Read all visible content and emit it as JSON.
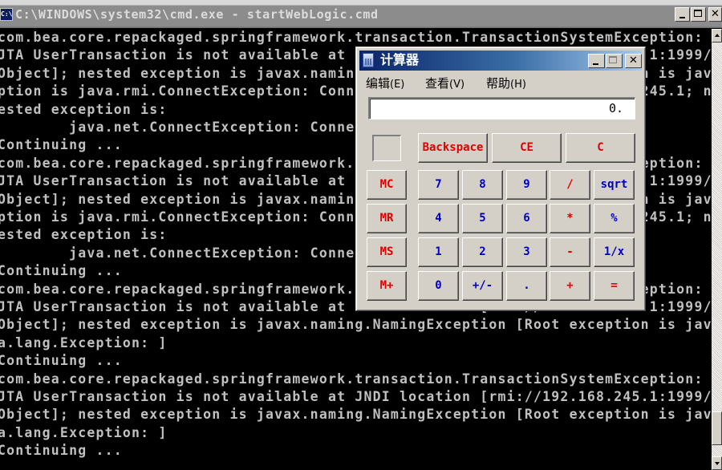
{
  "cmd_window": {
    "title": "C:\\WINDOWS\\system32\\cmd.exe - startWebLogic.cmd",
    "icon": "cmd-icon",
    "icon_text": "C:\\",
    "controls": {
      "minimize": "minimize-icon",
      "maximize": "maximize-icon",
      "close": "close-icon"
    },
    "console_lines": [
      "com.bea.core.repackaged.springframework.transaction.TransactionSystemException:",
      "JTA UserTransaction is not available at JNDI location [rmi://192.168.245.1:1999/",
      "Object]; nested exception is javax.naming.NamingException [Root exception is jav",
      "ption is java.rmi.ConnectException: Connection refused to host: 192.168.245.1; n",
      "ested exception is:",
      "        java.net.ConnectException: Connection refused: connect]",
      "Continuing ...",
      "com.bea.core.repackaged.springframework.transaction.TransactionSystemException:",
      "JTA UserTransaction is not available at JNDI location [rmi://192.168.245.1:1999/",
      "Object]; nested exception is javax.naming.NamingException [Root exception is jav",
      "ption is java.rmi.ConnectException: Connection refused to host: 192.168.245.1; n",
      "ested exception is:",
      "        java.net.ConnectException: Connection refused: connect]",
      "Continuing ...",
      "com.bea.core.repackaged.springframework.transaction.TransactionSystemException:",
      "JTA UserTransaction is not available at JNDI location [rmi://192.168.245.1:1999/",
      "Object]; nested exception is javax.naming.NamingException [Root exception is jav",
      "a.lang.Exception: ]",
      "Continuing ...",
      "com.bea.core.repackaged.springframework.transaction.TransactionSystemException:",
      "JTA UserTransaction is not available at JNDI location [rmi://192.168.245.1:1999/",
      "Object]; nested exception is javax.naming.NamingException [Root exception is jav",
      "a.lang.Exception: ]",
      "Continuing ..."
    ],
    "scrollbar": {
      "position_fraction": 0.97
    }
  },
  "calculator": {
    "title": "计算器",
    "icon": "calculator-icon",
    "menu": [
      {
        "label": "编辑",
        "accel": "(E)"
      },
      {
        "label": "查看",
        "accel": "(V)"
      },
      {
        "label": "帮助",
        "accel": "(H)"
      }
    ],
    "display_value": "0.",
    "memory_indicator": "",
    "top_buttons": [
      "Backspace",
      "CE",
      "C"
    ],
    "rows": [
      [
        {
          "label": "MC",
          "color": "red"
        },
        {
          "label": "7",
          "color": "blue"
        },
        {
          "label": "8",
          "color": "blue"
        },
        {
          "label": "9",
          "color": "blue"
        },
        {
          "label": "/",
          "color": "red"
        },
        {
          "label": "sqrt",
          "color": "blue"
        }
      ],
      [
        {
          "label": "MR",
          "color": "red"
        },
        {
          "label": "4",
          "color": "blue"
        },
        {
          "label": "5",
          "color": "blue"
        },
        {
          "label": "6",
          "color": "blue"
        },
        {
          "label": "*",
          "color": "red"
        },
        {
          "label": "%",
          "color": "blue"
        }
      ],
      [
        {
          "label": "MS",
          "color": "red"
        },
        {
          "label": "1",
          "color": "blue"
        },
        {
          "label": "2",
          "color": "blue"
        },
        {
          "label": "3",
          "color": "blue"
        },
        {
          "label": "-",
          "color": "red"
        },
        {
          "label": "1/x",
          "color": "blue"
        }
      ],
      [
        {
          "label": "M+",
          "color": "red"
        },
        {
          "label": "0",
          "color": "blue"
        },
        {
          "label": "+/-",
          "color": "blue"
        },
        {
          "label": ".",
          "color": "blue"
        },
        {
          "label": "+",
          "color": "red"
        },
        {
          "label": "=",
          "color": "red"
        }
      ]
    ],
    "colors": {
      "red_key": "#e00000",
      "blue_key": "#0000c0",
      "titlebar_start": "#0a246a",
      "titlebar_end": "#a6caf0"
    }
  }
}
